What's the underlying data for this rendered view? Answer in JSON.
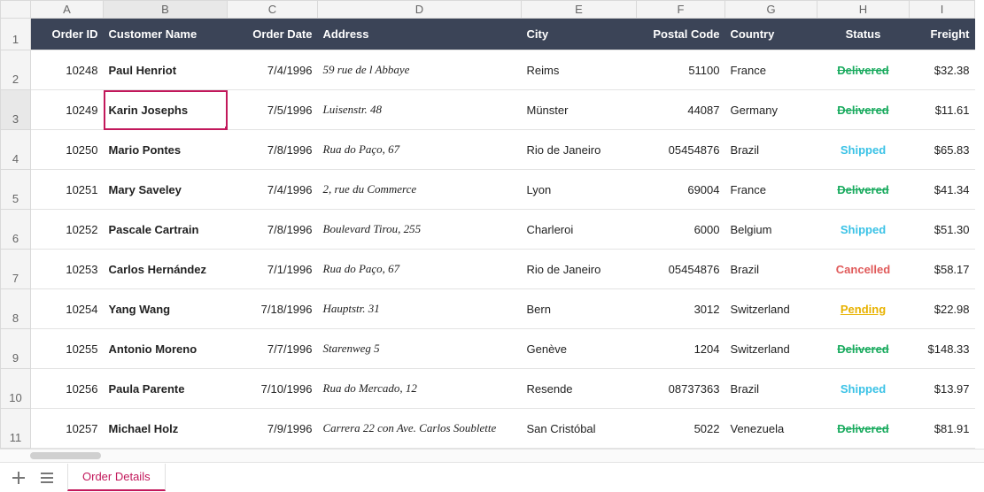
{
  "columns": [
    "A",
    "B",
    "C",
    "D",
    "E",
    "F",
    "G",
    "H",
    "I"
  ],
  "rowNumbers": [
    "1",
    "2",
    "3",
    "4",
    "5",
    "6",
    "7",
    "8",
    "9",
    "10",
    "11"
  ],
  "selectedCell": {
    "col": "B",
    "row": "3"
  },
  "headers": {
    "orderId": "Order ID",
    "customer": "Customer Name",
    "orderDate": "Order Date",
    "address": "Address",
    "city": "City",
    "postal": "Postal Code",
    "country": "Country",
    "status": "Status",
    "freight": "Freight"
  },
  "rows": [
    {
      "orderId": "10248",
      "customer": "Paul Henriot",
      "orderDate": "7/4/1996",
      "address": "59 rue de l Abbaye",
      "city": "Reims",
      "postal": "51100",
      "country": "France",
      "status": "Delivered",
      "statusKind": "delivered",
      "freight": "$32.38"
    },
    {
      "orderId": "10249",
      "customer": "Karin Josephs",
      "orderDate": "7/5/1996",
      "address": "Luisenstr. 48",
      "city": "Münster",
      "postal": "44087",
      "country": "Germany",
      "status": "Delivered",
      "statusKind": "delivered",
      "freight": "$11.61"
    },
    {
      "orderId": "10250",
      "customer": "Mario Pontes",
      "orderDate": "7/8/1996",
      "address": "Rua do Paço, 67",
      "city": "Rio de Janeiro",
      "postal": "05454876",
      "country": "Brazil",
      "status": "Shipped",
      "statusKind": "shipped",
      "freight": "$65.83"
    },
    {
      "orderId": "10251",
      "customer": "Mary Saveley",
      "orderDate": "7/4/1996",
      "address": "2, rue du Commerce",
      "city": "Lyon",
      "postal": "69004",
      "country": "France",
      "status": "Delivered",
      "statusKind": "delivered",
      "freight": "$41.34"
    },
    {
      "orderId": "10252",
      "customer": "Pascale Cartrain",
      "orderDate": "7/8/1996",
      "address": "Boulevard Tirou, 255",
      "city": "Charleroi",
      "postal": "6000",
      "country": "Belgium",
      "status": "Shipped",
      "statusKind": "shipped",
      "freight": "$51.30"
    },
    {
      "orderId": "10253",
      "customer": "Carlos Hernández",
      "orderDate": "7/1/1996",
      "address": "Rua do Paço, 67",
      "city": "Rio de Janeiro",
      "postal": "05454876",
      "country": "Brazil",
      "status": "Cancelled",
      "statusKind": "cancelled",
      "freight": "$58.17"
    },
    {
      "orderId": "10254",
      "customer": "Yang Wang",
      "orderDate": "7/18/1996",
      "address": "Hauptstr. 31",
      "city": "Bern",
      "postal": "3012",
      "country": "Switzerland",
      "status": "Pending",
      "statusKind": "pending",
      "freight": "$22.98"
    },
    {
      "orderId": "10255",
      "customer": "Antonio Moreno",
      "orderDate": "7/7/1996",
      "address": "Starenweg 5",
      "city": "Genève",
      "postal": "1204",
      "country": "Switzerland",
      "status": "Delivered",
      "statusKind": "delivered",
      "freight": "$148.33"
    },
    {
      "orderId": "10256",
      "customer": "Paula Parente",
      "orderDate": "7/10/1996",
      "address": "Rua do Mercado, 12",
      "city": "Resende",
      "postal": "08737363",
      "country": "Brazil",
      "status": "Shipped",
      "statusKind": "shipped",
      "freight": "$13.97"
    },
    {
      "orderId": "10257",
      "customer": "Michael Holz",
      "orderDate": "7/9/1996",
      "address": "Carrera 22 con Ave. Carlos Soublette",
      "city": "San Cristóbal",
      "postal": "5022",
      "country": "Venezuela",
      "status": "Delivered",
      "statusKind": "delivered",
      "freight": "$81.91"
    }
  ],
  "tabs": {
    "active": "Order Details"
  }
}
